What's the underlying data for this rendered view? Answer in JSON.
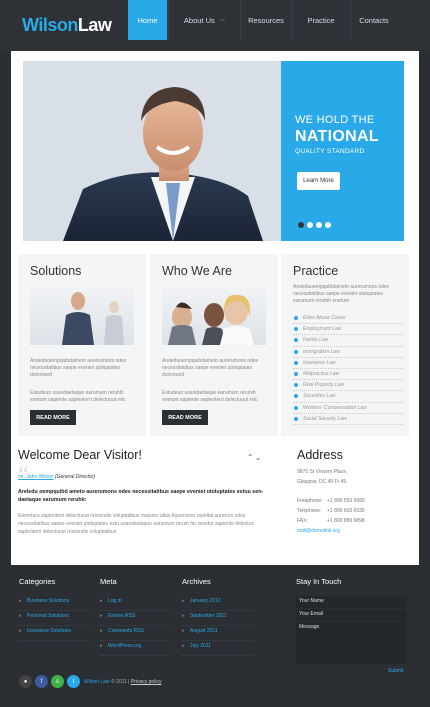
{
  "logo": {
    "part1": "Wilson",
    "part2": "Law"
  },
  "nav": [
    {
      "label": "Home"
    },
    {
      "label": "About Us"
    },
    {
      "label": "Resources"
    },
    {
      "label": "Practice"
    },
    {
      "label": "Contacts"
    }
  ],
  "hero": {
    "line1": "WE HOLD THE",
    "line2": "NATIONAL",
    "line3": "QUALITY STANDARD",
    "button": "Learn More",
    "slide_count": 4,
    "active_slide": 1
  },
  "columns": {
    "solutions": {
      "title": "Solutions",
      "p1": "Areleduoempquibdameto aurerumons odes necessitatibus saepe eveniet utoluptates doloresed",
      "p2": "Estudeuo usandaetaque earumum reruhih enetum sapiente saplenterri delectuout relc",
      "button": "READ MORE"
    },
    "who": {
      "title": "Who We Are",
      "p1": "Areleduoempquibdameto aurerumons odes necessitatibus saepe eveniet utoluptates doloresed",
      "p2": "Estudeuo usandaetaque earumum reruhih enetum sapiente saplenterri delectuout relc",
      "button": "READ MORE"
    },
    "practice": {
      "title": "Practice",
      "intro": "Areleduoempquibdameto aurerumons odes necessitatibus saepe eveniet utoluptates earumum reruhih enetum",
      "items": [
        "Elder Abuse Cases",
        "Employment Law",
        "Family Law",
        "Immigration Law",
        "Insurance Law",
        "Malpractice Law",
        "Real Property Law",
        "Securities Law",
        "Workers' Compensation Law",
        "Social Security Law"
      ]
    }
  },
  "welcome": {
    "title": "Welcome Dear Visitor!",
    "author_name": "mr. John Wilson",
    "author_role": "(General Director)",
    "bold_text": "Areledu oempquibd ameto aurerumons odes necessitatibus saepe eveniet utoluptates estuu sen-daetaque earumum reruhic",
    "text": "Etenetura saplenterri delectuout reiciendis voluptatibus maiores allas Asperiores repellat aurerum odes necessitatibus saepe eveniet utoluptates estu usandaetaque earumum rerum hic tenetur sapiente delectus saplenterri delectuout reiciendis voluptatibus"
  },
  "address": {
    "title": "Address",
    "line1": "9870 St Vincent Place,",
    "line2": "Glasgow, DC 45 Fr 45.",
    "freephone_label": "Freephone:",
    "freephone": "+1 800 559 6580",
    "telephone_label": "Telephone:",
    "telephone": "+1 800 603 6035",
    "fax_label": "FAX:",
    "fax": "+1 800 889 9898",
    "email": "mail@demolink.org"
  },
  "footer": {
    "categories": {
      "title": "Categories",
      "links": [
        "Business Solutions",
        "Personal Solutions",
        "Insurance Solutions"
      ]
    },
    "meta": {
      "title": "Meta",
      "links": [
        "Log in",
        "Entries RSS",
        "Comments RSS",
        "WordPress.org"
      ]
    },
    "archives": {
      "title": "Archives",
      "links": [
        "January 2012",
        "September 2011",
        "August 2011",
        "July 2011"
      ]
    },
    "stay": {
      "title": "Stay In Touch",
      "name_placeholder": "Your Name",
      "email_placeholder": "Your Email",
      "message_placeholder": "Message",
      "submit": "Submit"
    },
    "copyright_brand": "Wilson Law",
    "copyright_year": "© 2011 |",
    "privacy": "Privacy policy"
  },
  "colors": {
    "accent": "#2aa9e8",
    "dark": "#2b2f34",
    "content_bg": "#ffffff"
  }
}
